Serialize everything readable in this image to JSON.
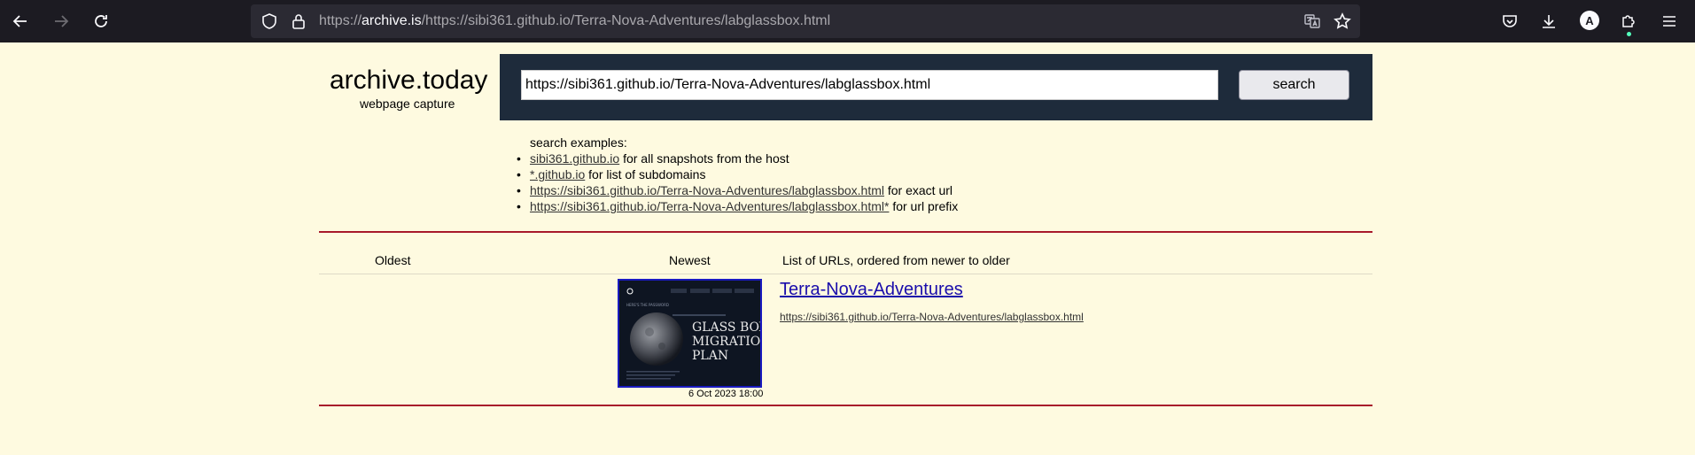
{
  "browser": {
    "url_prefix": "https://",
    "url_host": "archive.is",
    "url_rest": "/https://sibi361.github.io/Terra-Nova-Adventures/labglassbox.html",
    "avatar_letter": "A"
  },
  "header": {
    "logo_title": "archive.today",
    "logo_subtitle": "webpage capture"
  },
  "search": {
    "input_value": "https://sibi361.github.io/Terra-Nova-Adventures/labglassbox.html",
    "button_label": "search"
  },
  "examples": {
    "heading": "search examples:",
    "items": [
      {
        "link": "sibi361.github.io",
        "suffix": " for all snapshots from the host"
      },
      {
        "link": "*.github.io",
        "suffix": " for list of subdomains"
      },
      {
        "link": "https://sibi361.github.io/Terra-Nova-Adventures/labglassbox.html",
        "suffix": " for exact url"
      },
      {
        "link": "https://sibi361.github.io/Terra-Nova-Adventures/labglassbox.html*",
        "suffix": " for url prefix"
      }
    ]
  },
  "results_table": {
    "col_oldest": "Oldest",
    "col_newest": "Newest",
    "col_list": "List of URLs, ordered from newer to older"
  },
  "result": {
    "title": "Terra-Nova-Adventures",
    "url": "https://sibi361.github.io/Terra-Nova-Adventures/labglassbox.html",
    "date": "6 Oct 2023 18:00",
    "thumbnail": {
      "eyebrow": "HERE'S THE PASSWORD",
      "line1": "GLASS BOX",
      "line2": "MIGRATION",
      "line3": "PLAN"
    }
  }
}
